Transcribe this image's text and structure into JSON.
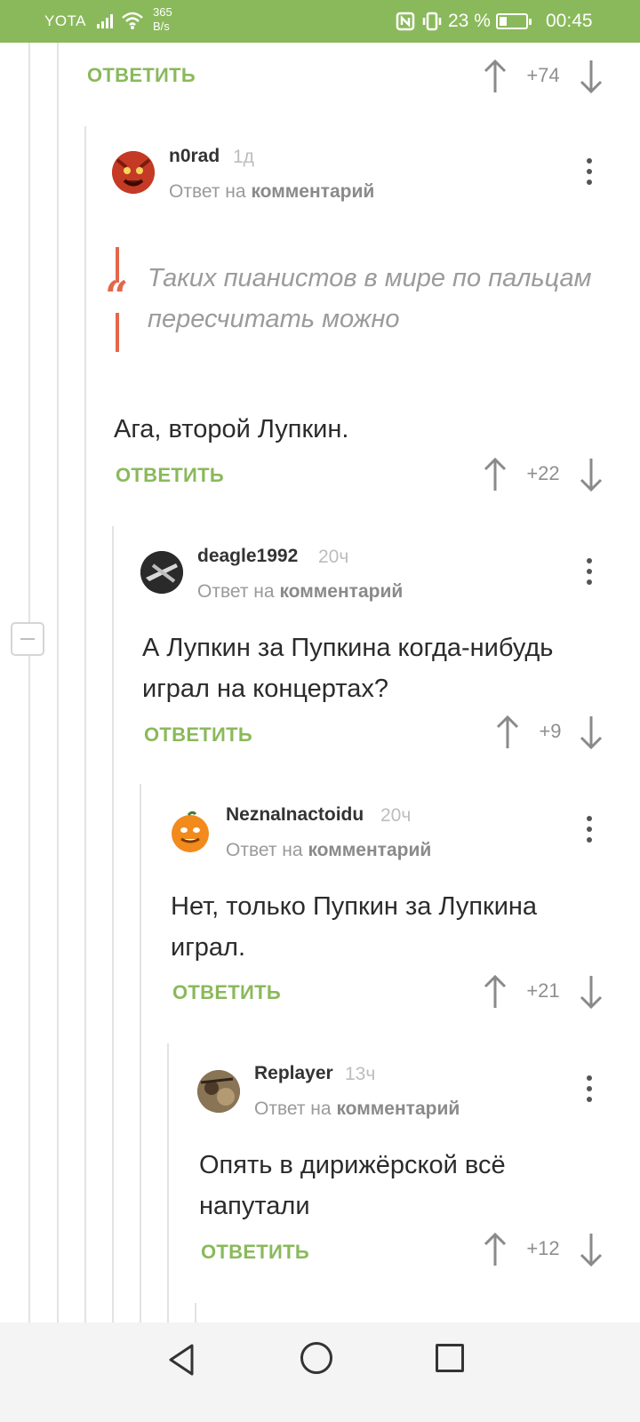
{
  "status_bar": {
    "carrier": "YOTA",
    "net_speed_value": "365",
    "net_speed_unit": "B/s",
    "battery_percent": "23 %",
    "time": "00:45",
    "icons": [
      "signal-icon",
      "wifi-icon",
      "nfc-icon",
      "vibrate-icon",
      "battery-icon"
    ]
  },
  "reply_label": "ОТВЕТИТЬ",
  "reply_to_prefix": "Ответ на",
  "reply_to_link": "комментарий",
  "top": {
    "score": "+74"
  },
  "comments": [
    {
      "username": "n0rad",
      "time": "1д",
      "quote": "Таких пианистов в мире по пальцам пересчитать можно",
      "text": "Ага, второй Лупкин.",
      "score": "+22"
    },
    {
      "username": "deagle1992",
      "time": "20ч",
      "text": "А Лупкин за Пупкина когда-нибудь играл на концертах?",
      "score": "+9"
    },
    {
      "username": "NeznaInactoidu",
      "time": "20ч",
      "text": "Нет, только Пупкин за Лупкина играл.",
      "score": "+21"
    },
    {
      "username": "Replayer",
      "time": "13ч",
      "text": "Опять в дирижёрской всё напутали",
      "score": "+12"
    }
  ],
  "colors": {
    "accent": "#8ab95b",
    "quote_mark": "#e4674a",
    "score": "#8f8f8f"
  }
}
